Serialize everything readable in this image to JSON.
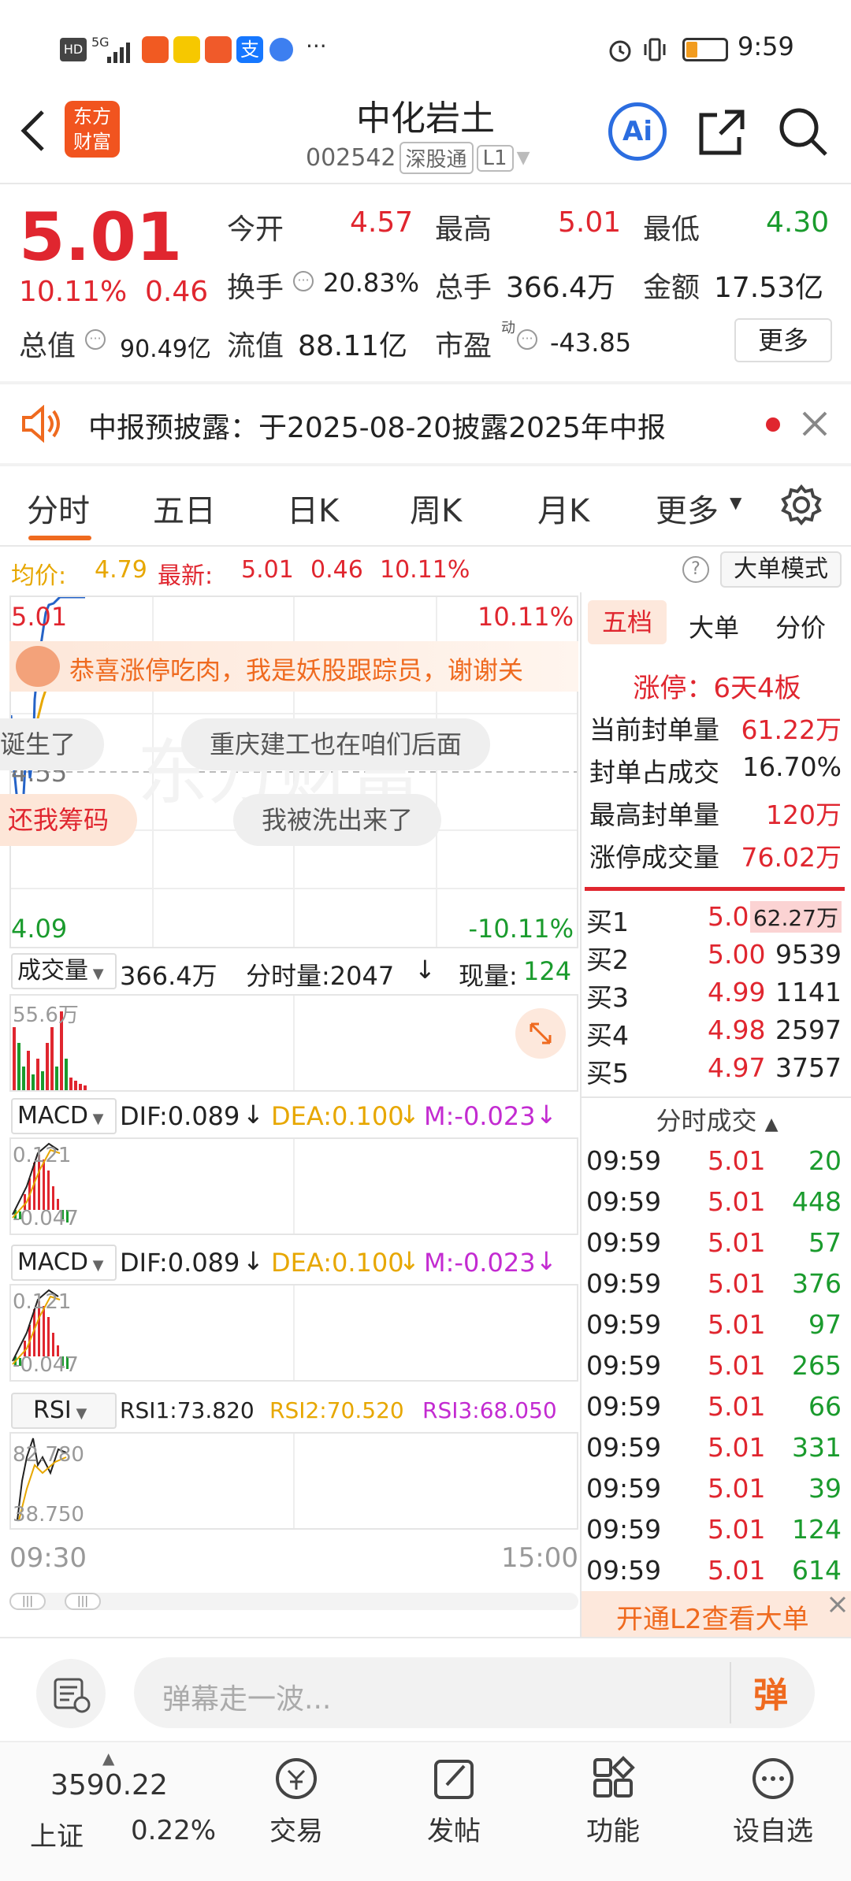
{
  "status_bar": {
    "left_text": "HD",
    "signal": "5G",
    "dots": "···",
    "time": "9:59"
  },
  "header": {
    "logo_line1": "东方",
    "logo_line2": "财富",
    "title": "中化岩土",
    "code": "002542",
    "tag1": "深股通",
    "tag2": "L1",
    "ai": "Ai"
  },
  "quote": {
    "price": "5.01",
    "pct": "10.11%",
    "chg": "0.46",
    "open_label": "今开",
    "open": "4.57",
    "high_label": "最高",
    "high": "5.01",
    "low_label": "最低",
    "low": "4.30",
    "turnover_label": "换手",
    "turnover": "20.83%",
    "volume_label": "总手",
    "volume": "366.4万",
    "amount_label": "金额",
    "amount": "17.53亿",
    "mktcap_label": "总值",
    "mktcap": "90.49亿",
    "float_label": "流值",
    "float": "88.11亿",
    "pe_label": "市盈",
    "pe_sup": "动",
    "pe": "-43.85",
    "more": "更多"
  },
  "notice": {
    "text": "中报预披露：于2025-08-20披露2025年中报"
  },
  "tabs": [
    "分时",
    "五日",
    "日K",
    "周K",
    "月K",
    "更多"
  ],
  "chart_header": {
    "avg_label": "均价:",
    "avg": "4.79",
    "latest_label": "最新:",
    "latest": "5.01",
    "chg": "0.46",
    "pct": "10.11%",
    "mode_btn": "大单模式",
    "help": "?"
  },
  "main_chart": {
    "top_price": "5.01",
    "top_pct": "10.11%",
    "mid_price": "4.55",
    "bot_price": "4.09",
    "bot_pct": "-10.11%",
    "watermark": "东方财富"
  },
  "danmaku": {
    "banner": "恭喜涨停吃肉，我是妖股跟踪员，谢谢关",
    "b1": "诞生了",
    "b2": "重庆建工也在咱们后面",
    "b3": "还我筹码",
    "b4": "我被洗出来了"
  },
  "volume": {
    "label": "成交量",
    "total": "366.4万",
    "tick_label": "分时量:2047",
    "now_label": "现量:",
    "now": "124",
    "scale": "55.6万"
  },
  "macd1": {
    "label": "MACD",
    "dif": "DIF:0.089",
    "dea": "DEA:0.100",
    "m": "M:-0.023",
    "top": "0.121",
    "bot": "-0.047"
  },
  "macd2": {
    "label": "MACD",
    "dif": "DIF:0.089",
    "dea": "DEA:0.100",
    "m": "M:-0.023",
    "top": "0.121",
    "bot": "-0.047"
  },
  "rsi": {
    "label": "RSI",
    "rsi1": "RSI1:73.820",
    "rsi2": "RSI2:70.520",
    "rsi3": "RSI3:68.050",
    "top": "82.780",
    "bot": "38.750"
  },
  "time_axis": {
    "start": "09:30",
    "end": "15:00"
  },
  "right_panel": {
    "tabs": [
      "五档",
      "大单",
      "分价"
    ],
    "limit_up": "涨停：6天4板",
    "stats": [
      {
        "label": "当前封单量",
        "value": "61.22万"
      },
      {
        "label": "封单占成交",
        "value": "16.70%"
      },
      {
        "label": "最高封单量",
        "value": "120万"
      },
      {
        "label": "涨停成交量",
        "value": "76.02万"
      }
    ],
    "bids": [
      {
        "label": "买1",
        "price": "5.01",
        "vol": "62.27万"
      },
      {
        "label": "买2",
        "price": "5.00",
        "vol": "9539"
      },
      {
        "label": "买3",
        "price": "4.99",
        "vol": "1141"
      },
      {
        "label": "买4",
        "price": "4.98",
        "vol": "2597"
      },
      {
        "label": "买5",
        "price": "4.97",
        "vol": "3757"
      }
    ],
    "ticks_title": "分时成交",
    "ticks": [
      {
        "time": "09:59",
        "price": "5.01",
        "vol": "20"
      },
      {
        "time": "09:59",
        "price": "5.01",
        "vol": "448"
      },
      {
        "time": "09:59",
        "price": "5.01",
        "vol": "57"
      },
      {
        "time": "09:59",
        "price": "5.01",
        "vol": "376"
      },
      {
        "time": "09:59",
        "price": "5.01",
        "vol": "97"
      },
      {
        "time": "09:59",
        "price": "5.01",
        "vol": "265"
      },
      {
        "time": "09:59",
        "price": "5.01",
        "vol": "66"
      },
      {
        "time": "09:59",
        "price": "5.01",
        "vol": "331"
      },
      {
        "time": "09:59",
        "price": "5.01",
        "vol": "39"
      },
      {
        "time": "09:59",
        "price": "5.01",
        "vol": "124"
      },
      {
        "time": "09:59",
        "price": "5.01",
        "vol": "614"
      }
    ],
    "l2_banner": "开通L2查看大单"
  },
  "comment_bar": {
    "placeholder": "弹幕走一波...",
    "btn": "弹"
  },
  "bottom_nav": {
    "index_value": "3590.22",
    "index_name": "上证",
    "index_pct": "0.22%",
    "items": [
      "交易",
      "发帖",
      "功能",
      "设自选"
    ]
  }
}
